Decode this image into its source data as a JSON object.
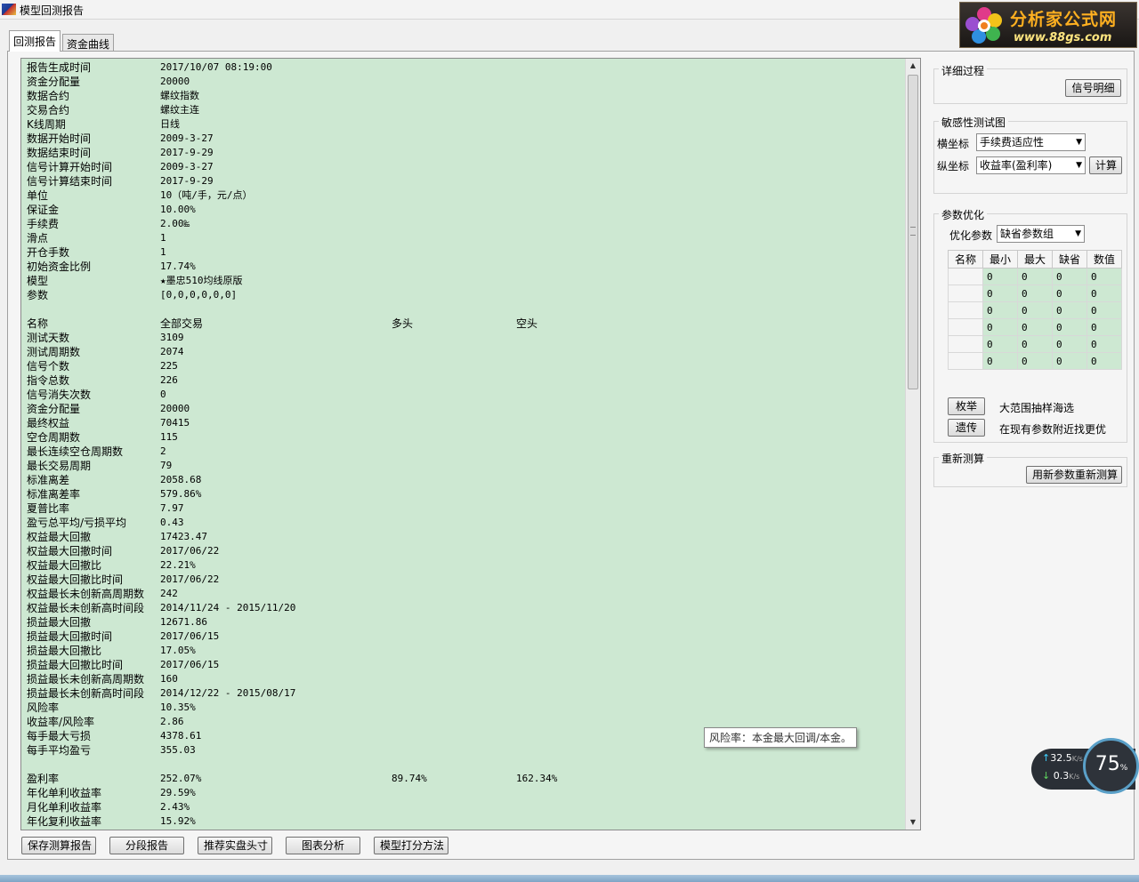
{
  "window": {
    "title": "模型回测报告"
  },
  "logo": {
    "main": "分析家公式网",
    "url": "www.88gs.com"
  },
  "tabs": [
    "回测报告",
    "资金曲线"
  ],
  "report": {
    "rows": [
      [
        "报告生成时间",
        "2017/10/07 08:19:00",
        "",
        ""
      ],
      [
        "资金分配量",
        "20000",
        "",
        ""
      ],
      [
        "数据合约",
        "螺纹指数",
        "",
        ""
      ],
      [
        "交易合约",
        "螺纹主连",
        "",
        ""
      ],
      [
        "K线周期",
        "日线",
        "",
        ""
      ],
      [
        "数据开始时间",
        "2009-3-27",
        "",
        ""
      ],
      [
        "数据结束时间",
        "2017-9-29",
        "",
        ""
      ],
      [
        "信号计算开始时间",
        "2009-3-27",
        "",
        ""
      ],
      [
        "信号计算结束时间",
        "2017-9-29",
        "",
        ""
      ],
      [
        "单位",
        "10（吨/手，元/点）",
        "",
        ""
      ],
      [
        "保证金",
        "10.00%",
        "",
        ""
      ],
      [
        "手续费",
        "2.00‱",
        "",
        ""
      ],
      [
        "滑点",
        "1",
        "",
        ""
      ],
      [
        "开仓手数",
        "1",
        "",
        ""
      ],
      [
        "初始资金比例",
        "17.74%",
        "",
        ""
      ],
      [
        "模型",
        "★墨忠510均线原版",
        "",
        ""
      ],
      [
        "参数",
        "[0,0,0,0,0,0]",
        "",
        ""
      ],
      [
        "",
        "",
        "",
        ""
      ],
      [
        "名称",
        "全部交易",
        "多头",
        "空头"
      ],
      [
        "测试天数",
        "3109",
        "",
        ""
      ],
      [
        "测试周期数",
        "2074",
        "",
        ""
      ],
      [
        "信号个数",
        "225",
        "",
        ""
      ],
      [
        "指令总数",
        "226",
        "",
        ""
      ],
      [
        "信号消失次数",
        "0",
        "",
        ""
      ],
      [
        "资金分配量",
        "20000",
        "",
        ""
      ],
      [
        "最终权益",
        "70415",
        "",
        ""
      ],
      [
        "空仓周期数",
        "115",
        "",
        ""
      ],
      [
        "最长连续空仓周期数",
        "2",
        "",
        ""
      ],
      [
        "最长交易周期",
        "79",
        "",
        ""
      ],
      [
        "标准离差",
        "2058.68",
        "",
        ""
      ],
      [
        "标准离差率",
        "579.86%",
        "",
        ""
      ],
      [
        "夏普比率",
        "7.97",
        "",
        ""
      ],
      [
        "盈亏总平均/亏损平均",
        "0.43",
        "",
        ""
      ],
      [
        "权益最大回撤",
        "17423.47",
        "",
        ""
      ],
      [
        "权益最大回撤时间",
        "2017/06/22",
        "",
        ""
      ],
      [
        "权益最大回撤比",
        "22.21%",
        "",
        ""
      ],
      [
        "权益最大回撤比时间",
        "2017/06/22",
        "",
        ""
      ],
      [
        "权益最长未创新高周期数",
        "242",
        "",
        ""
      ],
      [
        "权益最长未创新高时间段",
        "2014/11/24 - 2015/11/20",
        "",
        ""
      ],
      [
        "损益最大回撤",
        "12671.86",
        "",
        ""
      ],
      [
        "损益最大回撤时间",
        "2017/06/15",
        "",
        ""
      ],
      [
        "损益最大回撤比",
        "17.05%",
        "",
        ""
      ],
      [
        "损益最大回撤比时间",
        "2017/06/15",
        "",
        ""
      ],
      [
        "损益最长未创新高周期数",
        "160",
        "",
        ""
      ],
      [
        "损益最长未创新高时间段",
        "2014/12/22 - 2015/08/17",
        "",
        ""
      ],
      [
        "风险率",
        "10.35%",
        "",
        ""
      ],
      [
        "收益率/风险率",
        "2.86",
        "",
        ""
      ],
      [
        "每手最大亏损",
        "4378.61",
        "",
        ""
      ],
      [
        "每手平均盈亏",
        "355.03",
        "",
        ""
      ],
      [
        "",
        "",
        "",
        ""
      ],
      [
        "盈利率",
        "252.07%",
        "89.74%",
        "162.34%"
      ],
      [
        "年化单利收益率",
        "29.59%",
        "",
        ""
      ],
      [
        "月化单利收益率",
        "2.43%",
        "",
        ""
      ],
      [
        "年化复利收益率",
        "15.92%",
        "",
        ""
      ]
    ]
  },
  "tooltip": "风险率：本金最大回调/本金。",
  "bottom_buttons": [
    "保存测算报告",
    "分段报告",
    "推荐实盘头寸",
    "图表分析",
    "模型打分方法"
  ],
  "side": {
    "detail": {
      "title": "详细过程",
      "button": "信号明细"
    },
    "sensitivity": {
      "title": "敏感性测试图",
      "x_label": "横坐标",
      "x_value": "手续费适应性",
      "y_label": "纵坐标",
      "y_value": "收益率(盈利率)",
      "calc": "计算"
    },
    "optimize": {
      "title": "参数优化",
      "param_label": "优化参数",
      "param_value": "缺省参数组",
      "headers": [
        "名称",
        "最小",
        "最大",
        "缺省",
        "数值"
      ],
      "rows": [
        [
          "",
          "0",
          "0",
          "0",
          "0"
        ],
        [
          "",
          "0",
          "0",
          "0",
          "0"
        ],
        [
          "",
          "0",
          "0",
          "0",
          "0"
        ],
        [
          "",
          "0",
          "0",
          "0",
          "0"
        ],
        [
          "",
          "0",
          "0",
          "0",
          "0"
        ],
        [
          "",
          "0",
          "0",
          "0",
          "0"
        ]
      ],
      "enum_btn": "枚举",
      "enum_desc": "大范围抽样海选",
      "genetic_btn": "遗传",
      "genetic_desc": "在现有参数附近找更优"
    },
    "recalc": {
      "title": "重新测算",
      "button": "用新参数重新测算"
    }
  },
  "net": {
    "up": "32.5",
    "down": "0.3",
    "unit": "K/s",
    "percent": "75",
    "percent_sign": "%"
  },
  "colors": {
    "report_bg": "#cde8d2",
    "panel_bg": "#f5f5f5"
  }
}
